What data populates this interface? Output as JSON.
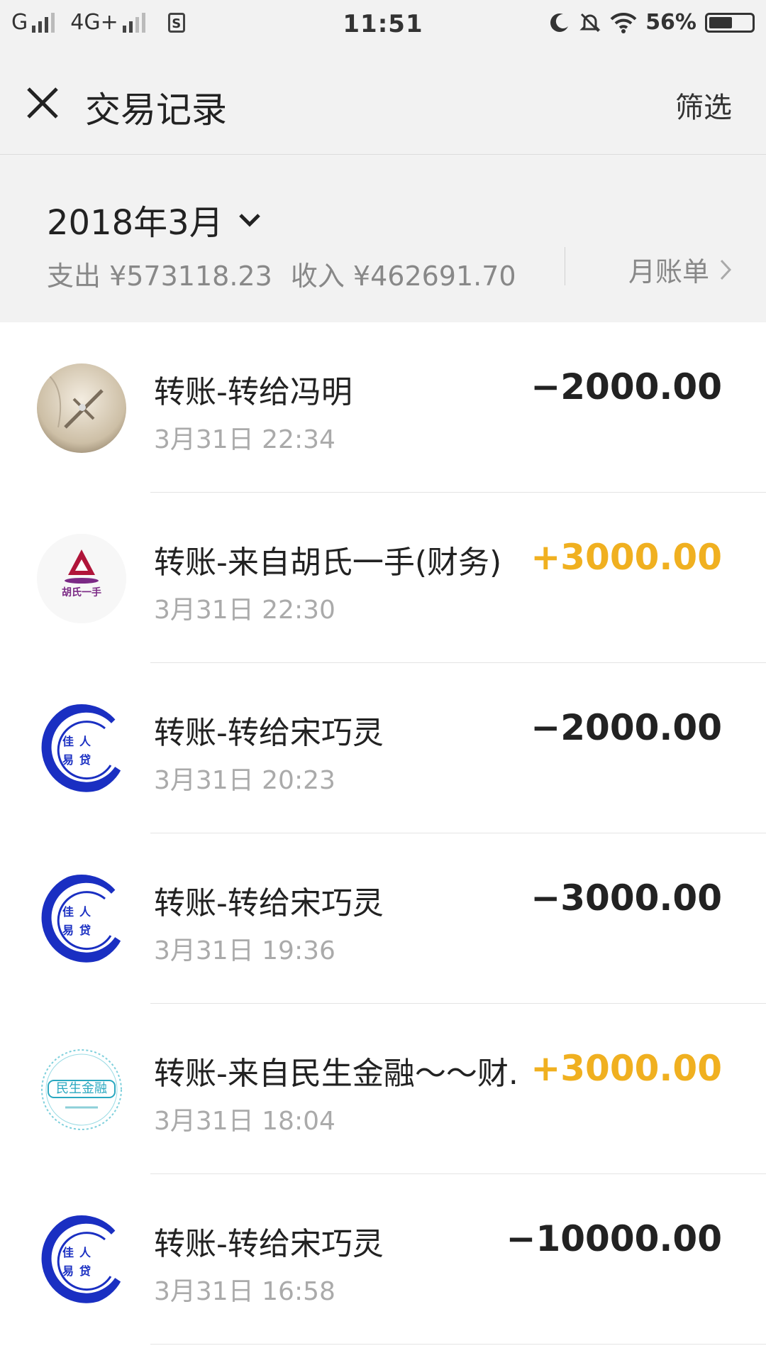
{
  "status_bar": {
    "carrier1": "G",
    "carrier2": "4G+",
    "time": "11:51",
    "battery": "56%",
    "battery_level": 0.56
  },
  "header": {
    "title": "交易记录",
    "filter": "筛选"
  },
  "summary": {
    "month": "2018年3月",
    "expense": "支出 ¥573118.23",
    "income": "收入 ¥462691.70",
    "monthly_bill": "月账单"
  },
  "transactions": [
    {
      "title": "转账-转给冯明",
      "time": "3月31日 22:34",
      "amount": "−2000.00",
      "type": "expense",
      "avatar": "crucifix-photo"
    },
    {
      "title": "转账-来自胡氏一手(财务)",
      "time": "3月31日 22:30",
      "amount": "+3000.00",
      "type": "income",
      "avatar": "hushi-logo",
      "avatar_text": "胡氏一手"
    },
    {
      "title": "转账-转给宋巧灵",
      "time": "3月31日 20:23",
      "amount": "−2000.00",
      "type": "expense",
      "avatar": "jiaren-logo",
      "avatar_text": "佳人易贷"
    },
    {
      "title": "转账-转给宋巧灵",
      "time": "3月31日 19:36",
      "amount": "−3000.00",
      "type": "expense",
      "avatar": "jiaren-logo",
      "avatar_text": "佳人易贷"
    },
    {
      "title": "转账-来自民生金融～～财.",
      "time": "3月31日 18:04",
      "amount": "+3000.00",
      "type": "income",
      "avatar": "minsheng-logo",
      "avatar_text": "民生金融"
    },
    {
      "title": "转账-转给宋巧灵",
      "time": "3月31日 16:58",
      "amount": "−10000.00",
      "type": "expense",
      "avatar": "jiaren-logo",
      "avatar_text": "佳人易贷"
    }
  ],
  "colors": {
    "income": "#f0b020",
    "expense": "#222222",
    "header_bg": "#f2f2f2"
  }
}
